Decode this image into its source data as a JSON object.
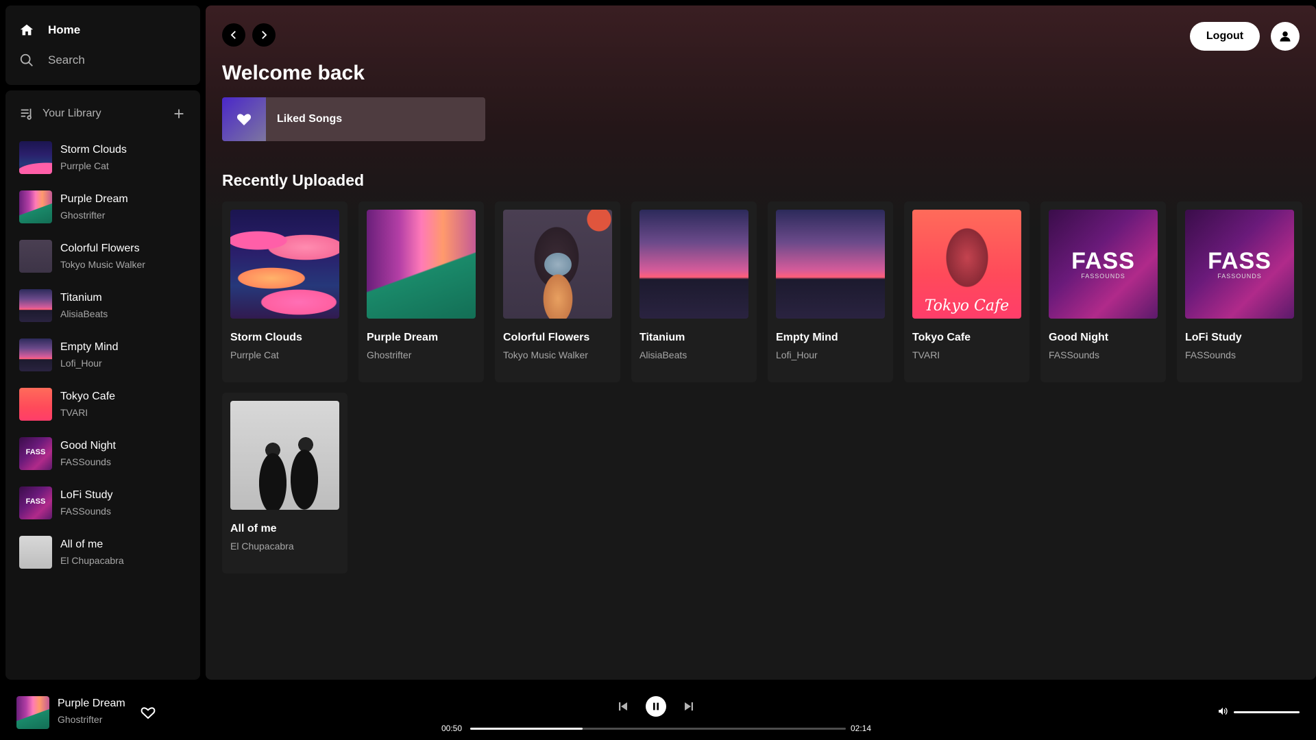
{
  "nav": {
    "home": "Home",
    "search": "Search"
  },
  "library": {
    "title": "Your Library",
    "items": [
      {
        "title": "Storm Clouds",
        "artist": "Purrple Cat",
        "art": "storm"
      },
      {
        "title": "Purple Dream",
        "artist": "Ghostrifter",
        "art": "purple"
      },
      {
        "title": "Colorful Flowers",
        "artist": "Tokyo Music Walker",
        "art": "flowers"
      },
      {
        "title": "Titanium",
        "artist": "AlisiaBeats",
        "art": "titan"
      },
      {
        "title": "Empty Mind",
        "artist": "Lofi_Hour",
        "art": "titan"
      },
      {
        "title": "Tokyo Cafe",
        "artist": "TVARI",
        "art": "tokyo"
      },
      {
        "title": "Good Night",
        "artist": "FASSounds",
        "art": "fass"
      },
      {
        "title": "LoFi Study",
        "artist": "FASSounds",
        "art": "fass"
      },
      {
        "title": "All of me",
        "artist": "El Chupacabra",
        "art": "allofme"
      }
    ]
  },
  "header": {
    "logout_label": "Logout"
  },
  "main": {
    "welcome": "Welcome back",
    "liked_songs": "Liked Songs",
    "recent_title": "Recently Uploaded",
    "cards": [
      {
        "title": "Storm Clouds",
        "artist": "Purrple Cat",
        "art": "storm"
      },
      {
        "title": "Purple Dream",
        "artist": "Ghostrifter",
        "art": "purple"
      },
      {
        "title": "Colorful Flowers",
        "artist": "Tokyo Music Walker",
        "art": "flowers"
      },
      {
        "title": "Titanium",
        "artist": "AlisiaBeats",
        "art": "titan"
      },
      {
        "title": "Empty Mind",
        "artist": "Lofi_Hour",
        "art": "titan"
      },
      {
        "title": "Tokyo Cafe",
        "artist": "TVARI",
        "art": "tokyo"
      },
      {
        "title": "Good Night",
        "artist": "FASSounds",
        "art": "fass"
      },
      {
        "title": "LoFi Study",
        "artist": "FASSounds",
        "art": "fass"
      },
      {
        "title": "All of me",
        "artist": "El Chupacabra",
        "art": "allofme"
      }
    ]
  },
  "art_text": {
    "fass_logo": "FASS",
    "fass_sub": "FASSOUNDS",
    "tokyo_script": "Tokyo Cafe"
  },
  "player": {
    "title": "Purple Dream",
    "artist": "Ghostrifter",
    "art": "purple",
    "current_time": "00:50",
    "total_time": "02:14",
    "progress": 0.3,
    "volume": 1.0,
    "state": "playing"
  },
  "icons": {
    "home": "home-icon",
    "search": "search-icon",
    "library": "library-icon",
    "add": "plus-icon",
    "back": "chevron-left-icon",
    "forward": "chevron-right-icon",
    "user": "user-icon",
    "heart": "heart-icon",
    "prev": "skip-back-icon",
    "pause": "pause-icon",
    "next": "skip-forward-icon",
    "volume": "volume-icon"
  }
}
